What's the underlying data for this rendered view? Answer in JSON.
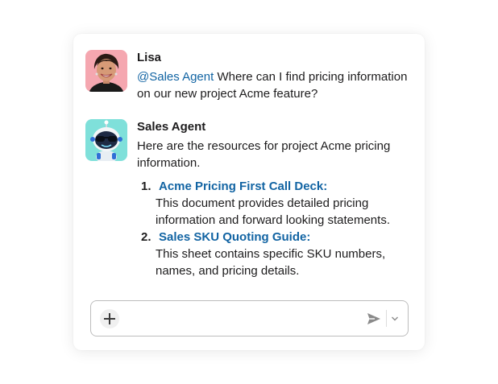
{
  "messages": [
    {
      "author": "Lisa",
      "avatar_icon": "person-avatar",
      "mention": "@Sales Agent",
      "text": " Where can I find pricing information on our new project Acme feature?"
    },
    {
      "author": "Sales Agent",
      "avatar_icon": "robot-avatar",
      "text": "Here are the resources for project Acme pricing information.",
      "resources": [
        {
          "number": "1.",
          "title": "Acme Pricing First Call Deck:",
          "description": "This document provides detailed pricing information and forward looking statements."
        },
        {
          "number": "2.",
          "title": "Sales SKU Quoting Guide:",
          "description": "This sheet contains specific SKU numbers, names, and pricing details."
        }
      ]
    }
  ],
  "composer": {
    "add_icon": "plus-icon",
    "send_icon": "send-icon",
    "options_icon": "chevron-down-icon",
    "value": ""
  },
  "colors": {
    "link": "#1264a3",
    "text": "#1d1c1d",
    "lisa_avatar_bg": "#f5a7b0",
    "agent_avatar_bg": "#7fe0da"
  }
}
